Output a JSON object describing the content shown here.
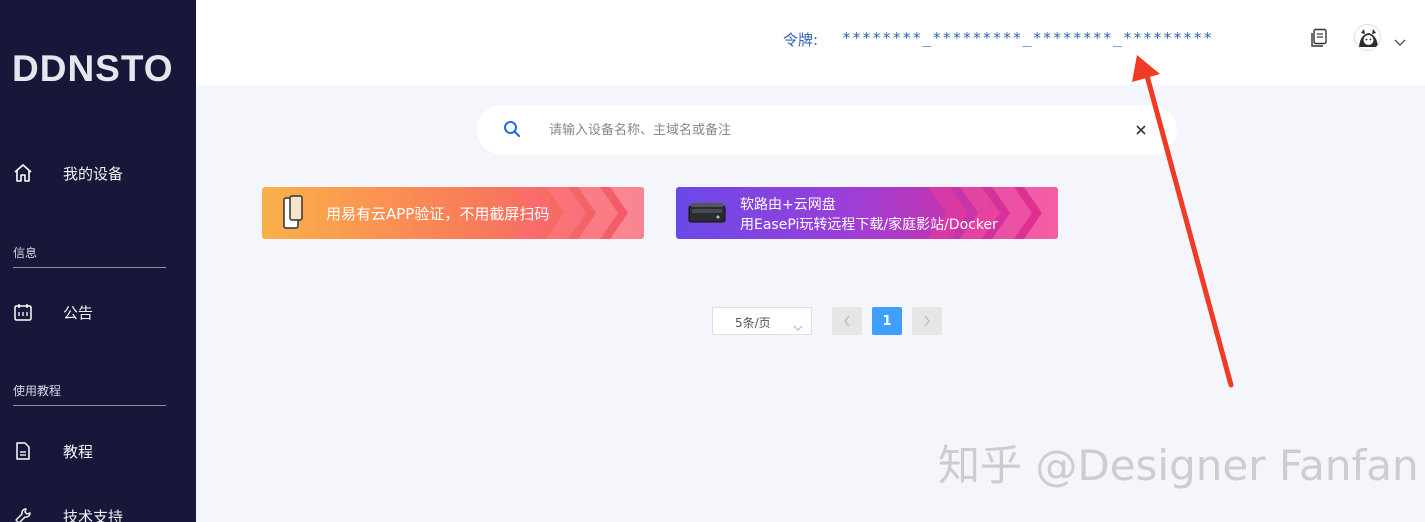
{
  "app": {
    "logo": "DDNSTO"
  },
  "sidebar": {
    "items": [
      {
        "label": "我的设备",
        "icon": "home-icon"
      },
      {
        "label": "公告",
        "icon": "calendar-icon"
      },
      {
        "label": "教程",
        "icon": "document-icon"
      },
      {
        "label": "技术支持",
        "icon": "wrench-icon"
      }
    ],
    "sections": [
      {
        "label": "信息"
      },
      {
        "label": "使用教程"
      }
    ]
  },
  "header": {
    "token_label": "令牌:",
    "token_value": "********_*********_********_*********",
    "copy_icon": "copy-icon",
    "avatar_icon": "avatar-icon",
    "dropdown_icon": "chevron-down-icon"
  },
  "search": {
    "placeholder": "请输入设备名称、主域名或备注",
    "value": "",
    "icon": "search-icon",
    "clear_icon": "close-icon"
  },
  "banners": [
    {
      "text": "用易有云APP验证，不用截屏扫码",
      "icon": "phone-icon"
    },
    {
      "line1": "软路由+云网盘",
      "line2": "用EasePi玩转远程下载/家庭影站/Docker",
      "icon": "router-icon"
    }
  ],
  "pagination": {
    "page_size": "5条/页",
    "current_page": "1",
    "prev_icon": "chevron-left-icon",
    "next_icon": "chevron-right-icon"
  },
  "watermark": "知乎 @Designer Fanfan",
  "colors": {
    "sidebar_bg": "#17173a",
    "token_text": "#2f63b5",
    "active_page": "#409eff",
    "annotation_arrow": "#f03a24"
  }
}
